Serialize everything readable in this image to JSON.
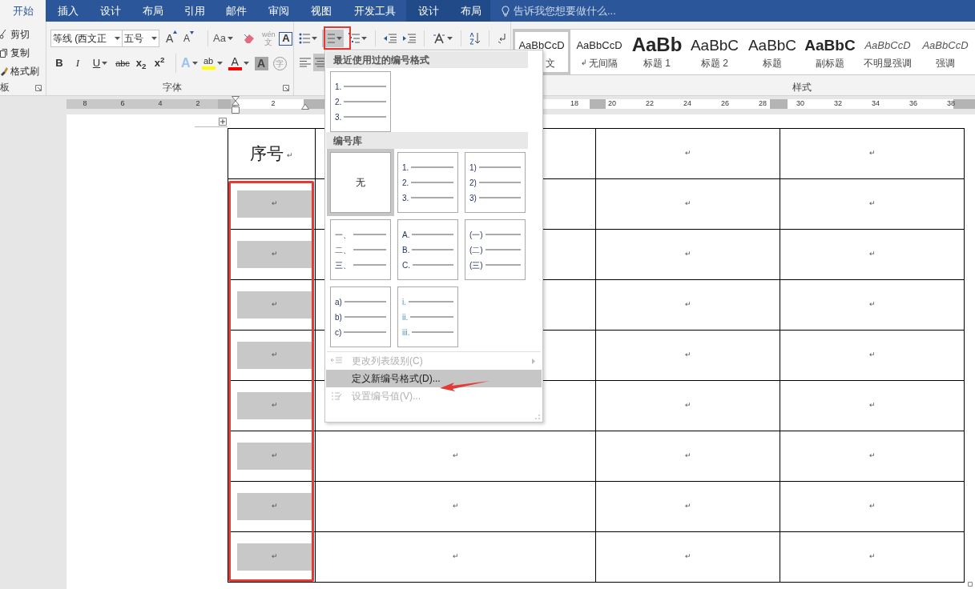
{
  "tabs": [
    {
      "label": "开始",
      "selected": true,
      "kind": "main"
    },
    {
      "label": "插入",
      "selected": false,
      "kind": "main"
    },
    {
      "label": "设计",
      "selected": false,
      "kind": "main"
    },
    {
      "label": "布局",
      "selected": false,
      "kind": "main"
    },
    {
      "label": "引用",
      "selected": false,
      "kind": "main"
    },
    {
      "label": "邮件",
      "selected": false,
      "kind": "main"
    },
    {
      "label": "审阅",
      "selected": false,
      "kind": "main"
    },
    {
      "label": "视图",
      "selected": false,
      "kind": "main"
    },
    {
      "label": "开发工具",
      "selected": false,
      "kind": "main"
    },
    {
      "label": "设计",
      "selected": false,
      "kind": "contextual"
    },
    {
      "label": "布局",
      "selected": false,
      "kind": "contextual"
    }
  ],
  "tell_me": {
    "placeholder": "告诉我您想要做什么..."
  },
  "clipboard": {
    "items": [
      "剪切",
      "复制",
      "格式刷"
    ],
    "label": "板"
  },
  "font": {
    "name": "等线 (西文正",
    "size": "五号",
    "label": "字体",
    "row1": [
      {
        "kind": "grow",
        "label": "A"
      },
      {
        "kind": "shrink",
        "label": "A"
      },
      {
        "kind": "case",
        "label": "Aa"
      },
      {
        "kind": "clear"
      },
      {
        "kind": "phonetic",
        "label": "wén",
        "sub": "文"
      },
      {
        "kind": "border",
        "label": "A"
      }
    ],
    "row2": [
      {
        "kind": "bold",
        "label": "B"
      },
      {
        "kind": "italic",
        "label": "I"
      },
      {
        "kind": "underline",
        "label": "U"
      },
      {
        "kind": "strike",
        "label": "abc"
      },
      {
        "kind": "subscript",
        "label": "x",
        "script": "2"
      },
      {
        "kind": "superscript",
        "label": "x",
        "script": "2"
      },
      {
        "kind": "effects",
        "label": "A"
      },
      {
        "kind": "highlight",
        "label": "ab",
        "color": "#ffff00"
      },
      {
        "kind": "color",
        "label": "A",
        "color": "#ff0000"
      },
      {
        "kind": "shading",
        "label": "A"
      },
      {
        "kind": "enclose",
        "label": "字"
      }
    ]
  },
  "paragraph": {
    "row1": [
      {
        "kind": "bullets",
        "pressed": false
      },
      {
        "kind": "numbering",
        "pressed": true
      },
      {
        "kind": "multilevel",
        "pressed": false
      },
      {
        "kind": "outdent",
        "pressed": false
      },
      {
        "kind": "indent",
        "pressed": false
      },
      {
        "kind": "asian",
        "pressed": false
      },
      {
        "kind": "sort",
        "pressed": false
      },
      {
        "kind": "marks",
        "pressed": false
      }
    ],
    "row2": [
      {
        "kind": "align-left",
        "pressed": false
      },
      {
        "kind": "align-center",
        "pressed": true
      }
    ]
  },
  "styles": {
    "label": "样式",
    "items": [
      {
        "preview": "AaBbCcD",
        "name": "文",
        "kind": "normal",
        "selected": true
      },
      {
        "preview": "AaBbCcD",
        "name": "无间隔",
        "mark": "↲",
        "kind": "normal",
        "selected": false
      },
      {
        "preview": "AaBb",
        "name": "标题 1",
        "kind": "h1",
        "selected": false
      },
      {
        "preview": "AaBbC",
        "name": "标题 2",
        "kind": "h2",
        "selected": false
      },
      {
        "preview": "AaBbC",
        "name": "标题",
        "kind": "title",
        "selected": false
      },
      {
        "preview": "AaBbC",
        "name": "副标题",
        "kind": "bold",
        "selected": false
      },
      {
        "preview": "AaBbCcD",
        "name": "不明显强调",
        "kind": "italic",
        "selected": false
      },
      {
        "preview": "AaBbCcD",
        "name": "强调",
        "kind": "italic",
        "selected": false
      }
    ]
  },
  "ruler": {
    "left_labels": [
      "8",
      "6",
      "4",
      "2"
    ],
    "right_labels": [
      "2",
      "18",
      "20",
      "22",
      "24",
      "26",
      "28",
      "30",
      "32",
      "34",
      "36",
      "38"
    ]
  },
  "table": {
    "header": {
      "title": "序号",
      "mark": "↵",
      "cells": [
        null,
        "↵",
        "↵"
      ]
    },
    "rows": [
      {
        "number": "↵",
        "cells": [
          null,
          "↵",
          "↵"
        ]
      },
      {
        "number": "↵",
        "cells": [
          null,
          "↵",
          "↵"
        ]
      },
      {
        "number": "↵",
        "cells": [
          null,
          "↵",
          "↵"
        ]
      },
      {
        "number": "↵",
        "cells": [
          null,
          "↵",
          "↵"
        ]
      },
      {
        "number": "↵",
        "cells": [
          null,
          "↵",
          "↵"
        ]
      },
      {
        "number": "↵",
        "cells": [
          "↵",
          "↵",
          "↵"
        ]
      },
      {
        "number": "↵",
        "cells": [
          "↵",
          "↵",
          "↵"
        ]
      },
      {
        "number": "↵",
        "cells": [
          "↵",
          "↵",
          "↵"
        ]
      }
    ]
  },
  "numbering_menu": {
    "recent_header": "最近使用过的编号格式",
    "recent": [
      {
        "kind": "list",
        "lines": [
          "1.",
          "2.",
          "3."
        ]
      }
    ],
    "library_header": "编号库",
    "library": [
      {
        "kind": "none",
        "label": "无",
        "selected": true
      },
      {
        "kind": "list",
        "lines": [
          "1.",
          "2.",
          "3."
        ],
        "selected": false
      },
      {
        "kind": "list",
        "lines": [
          "1)",
          "2)",
          "3)"
        ],
        "selected": false
      },
      {
        "kind": "list",
        "lines": [
          "一、",
          "二、",
          "三、"
        ],
        "selected": false
      },
      {
        "kind": "list",
        "lines": [
          "A.",
          "B.",
          "C."
        ],
        "selected": false
      },
      {
        "kind": "list",
        "lines": [
          "(一)",
          "(二)",
          "(三)"
        ],
        "selected": false
      },
      {
        "kind": "list",
        "lines": [
          "a)",
          "b)",
          "c)"
        ],
        "selected": false
      },
      {
        "kind": "roman",
        "lines": [
          "i.",
          "ii.",
          "iii."
        ],
        "selected": false
      }
    ],
    "commands": [
      {
        "label": "更改列表级别(C)",
        "disabled": true,
        "highlighted": false,
        "submenu": true
      },
      {
        "label": "定义新编号格式(D)...",
        "disabled": false,
        "highlighted": true,
        "submenu": false
      },
      {
        "label": "设置编号值(V)...",
        "disabled": true,
        "highlighted": false,
        "submenu": false
      }
    ]
  },
  "annotations": {
    "button_frame": true,
    "column_frame": true,
    "arrow": true
  }
}
